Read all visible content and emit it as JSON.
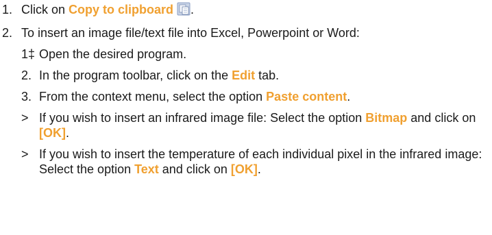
{
  "steps": [
    {
      "num": "1.",
      "text_before": "Click on ",
      "highlight": "Copy to clipboard",
      "text_after": ".",
      "icon": "clipboard-copy-icon"
    },
    {
      "num": "2.",
      "text": "To insert an image file/text file into Excel, Powerpoint or Word:",
      "substeps": [
        {
          "num": "1‡",
          "text": "Open the desired program."
        },
        {
          "num": "2.",
          "text_before": "In the program toolbar, click on the ",
          "highlight": "Edit",
          "text_after": " tab."
        },
        {
          "num": "3.",
          "text_before": "From the context menu, select the option ",
          "highlight": "Paste content",
          "text_after": "."
        },
        {
          "num": ">",
          "text_before": "If you wish to insert an infrared image file: Select the option ",
          "highlight": "Bitmap",
          "text_mid": " and click on ",
          "highlight2": "[OK]",
          "text_after": "."
        },
        {
          "num": ">",
          "text_before": "If you wish to insert the temperature of each individual pixel in the infrared image: Select the option ",
          "highlight": "Text",
          "text_mid": " and click on ",
          "highlight2": "[OK]",
          "text_after": "."
        }
      ]
    }
  ],
  "colors": {
    "highlight": "#f0a030",
    "text": "#1a1a1a"
  }
}
